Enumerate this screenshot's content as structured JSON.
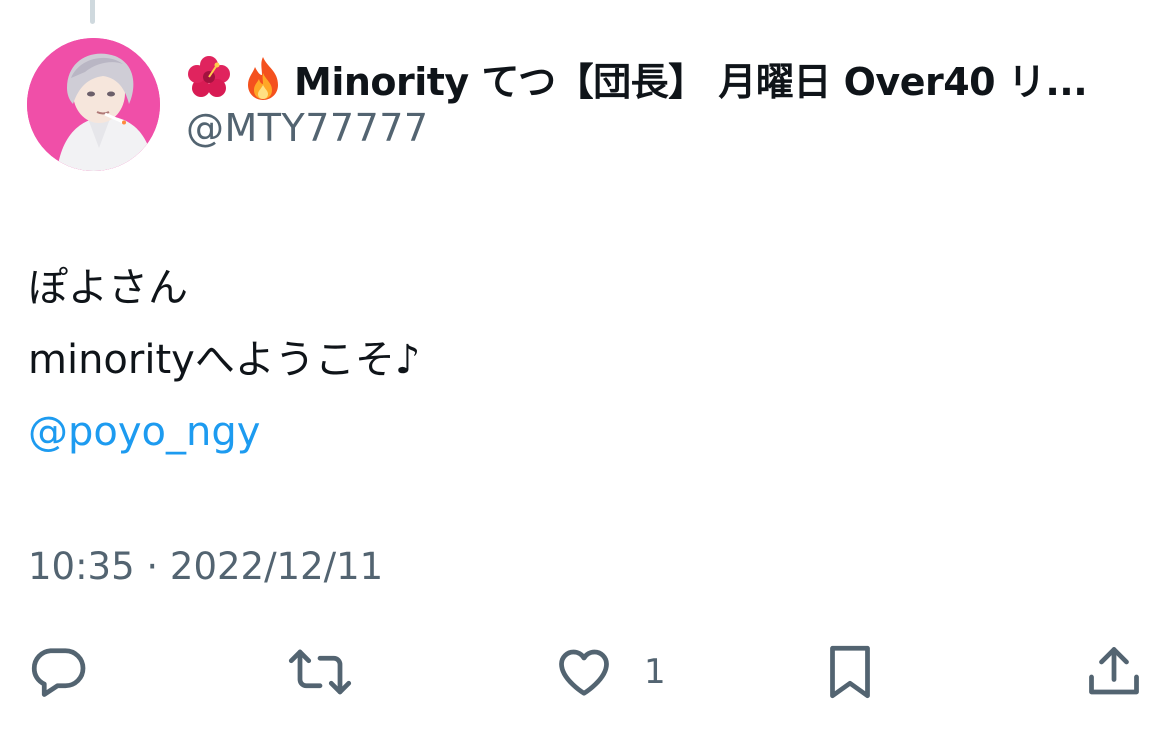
{
  "tweet": {
    "author": {
      "emojis": [
        "hibiscus-emoji",
        "fire-emoji"
      ],
      "display_name": "Minority てつ【団長】 月曜日 Over40 リ...",
      "handle": "@MTY77777"
    },
    "body_lines": [
      "ぽよさん",
      "minorityへようこそ♪"
    ],
    "mention": "@poyo_ngy",
    "timestamp": "10:35 · 2022/12/11"
  },
  "actions": {
    "reply": {
      "icon": "reply-icon"
    },
    "retweet": {
      "icon": "retweet-icon"
    },
    "like": {
      "icon": "heart-icon",
      "count": "1"
    },
    "bookmark": {
      "icon": "bookmark-icon"
    },
    "share": {
      "icon": "share-icon"
    }
  },
  "colors": {
    "text": "#0f1419",
    "secondary": "#536471",
    "link": "#1d9bf0",
    "avatar_bg": "#f04fa8"
  }
}
